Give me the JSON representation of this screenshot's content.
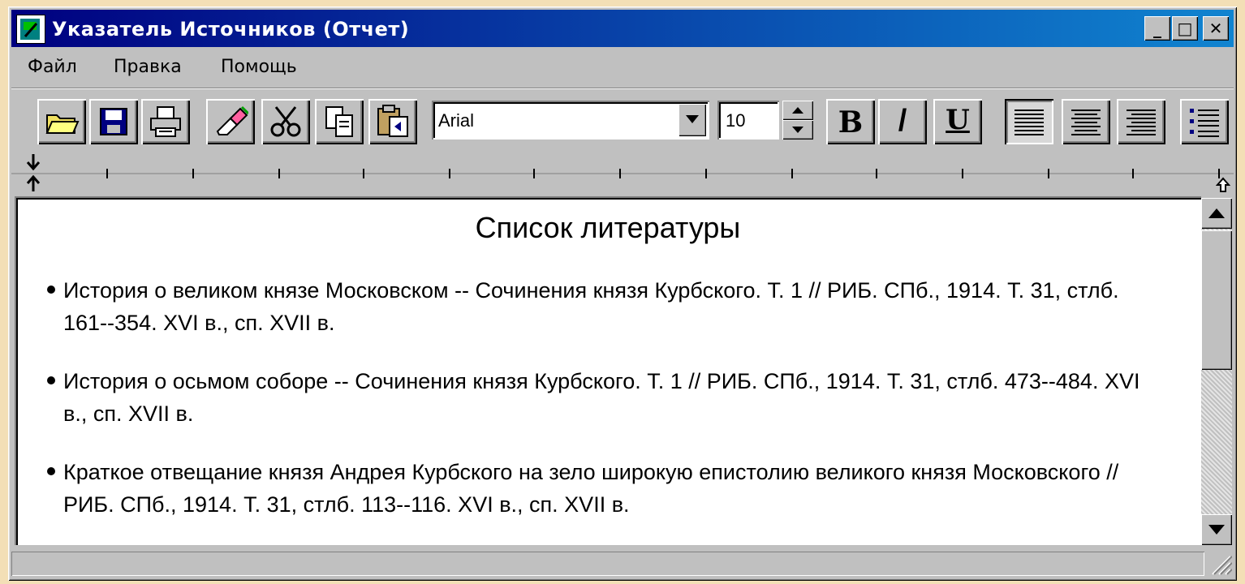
{
  "window": {
    "title": "Указатель Источников (Отчет)",
    "controls": {
      "minimize": "_",
      "maximize": "□",
      "close": "✕"
    }
  },
  "menu": [
    "Файл",
    "Правка",
    "Помощь"
  ],
  "toolbar": {
    "icons": [
      "open-folder-icon",
      "save-disk-icon",
      "print-icon",
      "eraser-icon",
      "scissors-icon",
      "copy-icon",
      "paste-icon"
    ],
    "font": "Arial",
    "font_size": "10",
    "bold": "B",
    "italic": "/",
    "underline": "U",
    "align": [
      "align-left-icon",
      "align-center-icon",
      "align-right-icon"
    ],
    "list": "bullet-list-icon"
  },
  "document": {
    "title": "Список литературы",
    "entries": [
      "История о великом князе Московском -- Сочинения князя Курбского.  Т. 1 // РИБ. СПб., 1914. Т. 31, стлб. 161--354. XVI в.,  сп. XVII в.",
      " История о осьмом соборе -- Сочинения князя Курбского.  Т. 1 // РИБ. СПб., 1914. Т. 31, стлб. 473--484. XVI в.,  сп. XVII в.",
      " Краткое отвещание князя Андрея Курбского на зело широкую епистолию  великого князя Московского // РИБ. СПб., 1914. Т. 31, стлб. 113--116. XVI в.,  сп. XVII в."
    ]
  },
  "colors": {
    "titlebar_start": "#000080",
    "titlebar_end": "#1084d0",
    "face": "#c0c0c0",
    "desktop": "#f3dfb6"
  }
}
